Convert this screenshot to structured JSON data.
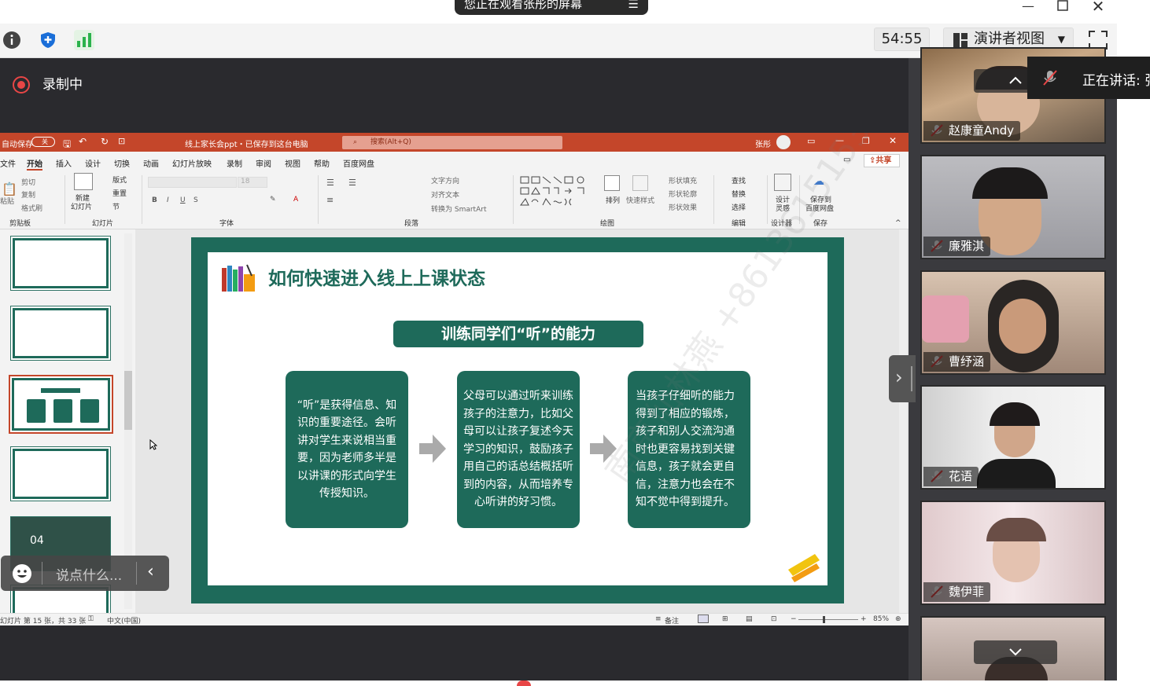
{
  "banner": {
    "text": "您正在观看张彤的屏幕"
  },
  "toolbar": {
    "timer": "54:55",
    "view_mode": "演讲者视图",
    "icons": [
      "info-icon",
      "shield-icon",
      "signal-icon",
      "fullscreen-icon"
    ]
  },
  "recording": {
    "label": "录制中",
    "color": "#e84646"
  },
  "ppt": {
    "autosave": "自动保存",
    "autosave_toggle": "关",
    "doc_title": "线上家长会ppt・已保存到这台电脑",
    "search_placeholder": "搜索(Alt+Q)",
    "user": "张彤",
    "menu": [
      "文件",
      "开始",
      "插入",
      "设计",
      "切换",
      "动画",
      "幻灯片放映",
      "录制",
      "审阅",
      "视图",
      "帮助",
      "百度网盘"
    ],
    "share": "共享",
    "ribbon": {
      "clipboard": {
        "paste": "粘贴",
        "cut": "剪切",
        "copy": "复制",
        "format_painter": "格式刷",
        "group": "剪贴板"
      },
      "slides": {
        "new_slide_line1": "新建",
        "new_slide_line2": "幻灯片",
        "layout": "版式",
        "reset": "重置",
        "section": "节",
        "group": "幻灯片"
      },
      "font": {
        "size": "18",
        "group": "字体"
      },
      "paragraph": {
        "text_direction": "文字方向",
        "align_text": "对齐文本",
        "smartart": "转换为 SmartArt",
        "group": "段落"
      },
      "drawing": {
        "arrange": "排列",
        "quick_styles": "快速样式",
        "shape_fill": "形状填充",
        "shape_outline": "形状轮廓",
        "shape_effects": "形状效果",
        "group": "绘图"
      },
      "editing": {
        "find": "查找",
        "replace": "替换",
        "select": "选择",
        "group": "编辑"
      },
      "designer": {
        "label_line1": "设计",
        "label_line2": "灵感",
        "group": "设计器"
      },
      "save": {
        "label_line1": "保存到",
        "label_line2": "百度网盘",
        "group": "保存"
      }
    },
    "slide": {
      "title": "如何快速进入线上上课状态",
      "subtitle": "训练同学们“听”的能力",
      "cards": [
        "“听”是获得信息、知识的重要途径。会听讲对学生来说相当重要，因为老师多半是以讲课的形式向学生传授知识。",
        "父母可以通过听来训练孩子的注意力，比如父母可以让孩子复述今天学习的知识，鼓励孩子用自己的话总结概括听到的内容，从而培养专心听讲的好习惯。",
        "当孩子仔细听的能力得到了相应的锻炼，孩子和别人交流沟通时也更容易找到关键信息，孩子就会更自信，注意力也会在不知不觉中得到提升。"
      ],
      "accent_color": "#1e6a5a",
      "watermark": "南京仙林燕 +8613615153"
    },
    "thumb_number": "04",
    "status": {
      "slide_info": "幻灯片 第 15 张，共 33 张",
      "language": "中文(中国)",
      "notes": "备注",
      "zoom": "85%"
    }
  },
  "chat": {
    "placeholder": "说点什么..."
  },
  "participants": [
    {
      "name": "赵康童Andy"
    },
    {
      "name": "廉雅淇"
    },
    {
      "name": "曹纾涵"
    },
    {
      "name": "花语"
    },
    {
      "name": "魏伊菲"
    },
    {
      "name": ""
    }
  ],
  "speaking": {
    "label": "正在讲话: 张"
  }
}
